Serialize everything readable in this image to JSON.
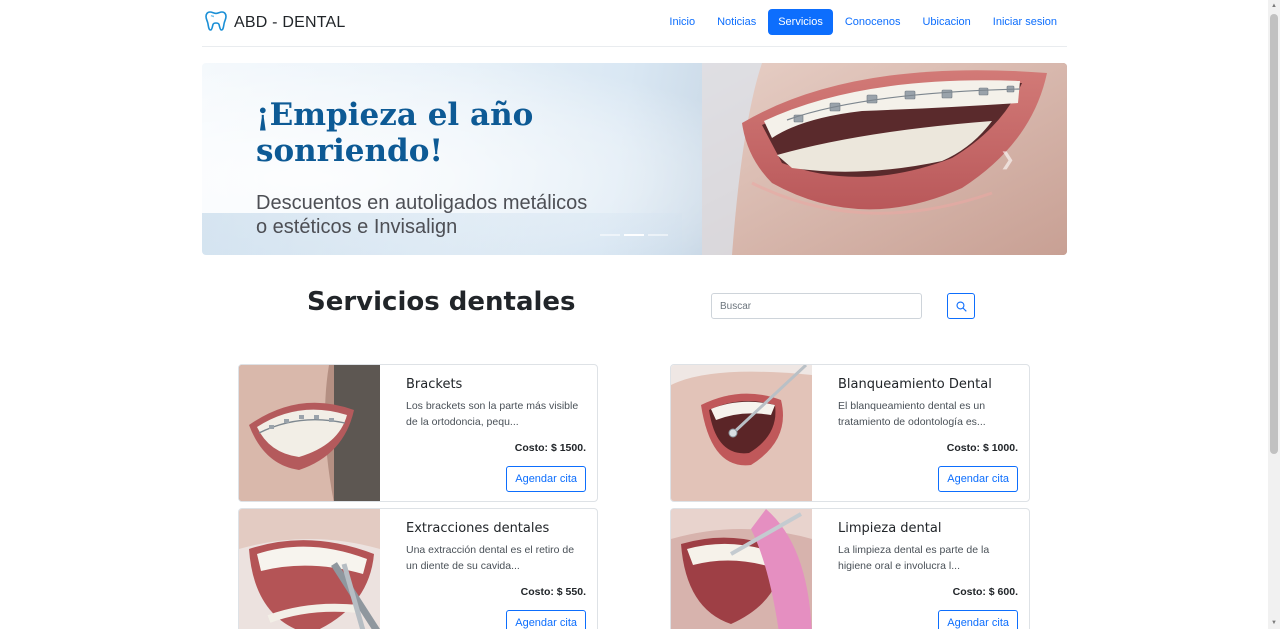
{
  "brand": {
    "name": "ABD - DENTAL",
    "icon": "tooth-icon"
  },
  "nav": {
    "items": [
      {
        "label": "Inicio"
      },
      {
        "label": "Noticias"
      },
      {
        "label": "Servicios",
        "active": true
      },
      {
        "label": "Conocenos"
      },
      {
        "label": "Ubicacion"
      },
      {
        "label": "Iniciar sesion"
      }
    ]
  },
  "banner": {
    "headline_line1": "¡Empieza el año",
    "headline_line2": "sonriendo!",
    "sub_line1": "Descuentos en autoligados metálicos",
    "sub_line2": "o estéticos e Invisalign"
  },
  "services": {
    "title": "Servicios dentales",
    "search_placeholder": "Buscar",
    "search_icon": "search-icon"
  },
  "cards": [
    {
      "title": "Brackets",
      "description": "Los brackets son la parte más visible de la ortodoncia, pequ...",
      "cost": "Costo: $ 1500.",
      "button": "Agendar cita"
    },
    {
      "title": "Blanqueamiento Dental",
      "description": "El blanqueamiento dental es un tratamiento de odontología es...",
      "cost": "Costo: $ 1000.",
      "button": "Agendar cita"
    },
    {
      "title": "Extracciones dentales",
      "description": "Una extracción dental es el retiro de un diente de su cavida...",
      "cost": "Costo: $ 550.",
      "button": "Agendar cita"
    },
    {
      "title": "Limpieza dental",
      "description": "La limpieza dental es parte de la higiene oral e involucra l...",
      "cost": "Costo: $ 600.",
      "button": "Agendar cita"
    }
  ],
  "colors": {
    "primary": "#0d6efd",
    "headline": "#0d5a95"
  }
}
